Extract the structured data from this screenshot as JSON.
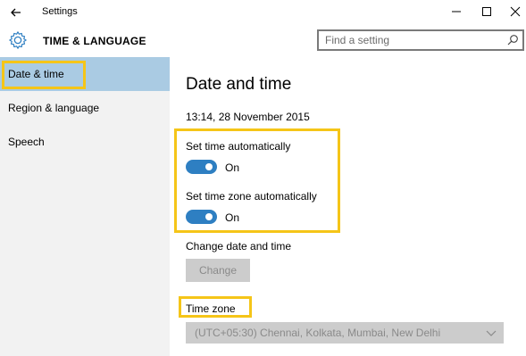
{
  "window": {
    "title": "Settings"
  },
  "header": {
    "title": "TIME & LANGUAGE",
    "search_placeholder": "Find a setting"
  },
  "sidebar": {
    "items": [
      {
        "label": "Date & time",
        "selected": true
      },
      {
        "label": "Region & language",
        "selected": false
      },
      {
        "label": "Speech",
        "selected": false
      }
    ]
  },
  "main": {
    "heading": "Date and time",
    "current_datetime": "13:14, 28 November 2015",
    "set_time_auto": {
      "label": "Set time automatically",
      "state": "On"
    },
    "set_timezone_auto": {
      "label": "Set time zone automatically",
      "state": "On"
    },
    "change_section_label": "Change date and time",
    "change_button": "Change",
    "timezone_label": "Time zone",
    "timezone_value": "(UTC+05:30) Chennai, Kolkata, Mumbai, New Delhi"
  },
  "colors": {
    "accent": "#2e7fc2",
    "sidebar_selected": "#aacbe3",
    "highlight": "#f5c518",
    "disabled": "#cccccc"
  },
  "icons": [
    "back-arrow-icon",
    "minimize-icon",
    "maximize-icon",
    "close-icon",
    "gear-icon",
    "search-icon",
    "chevron-down-icon"
  ]
}
